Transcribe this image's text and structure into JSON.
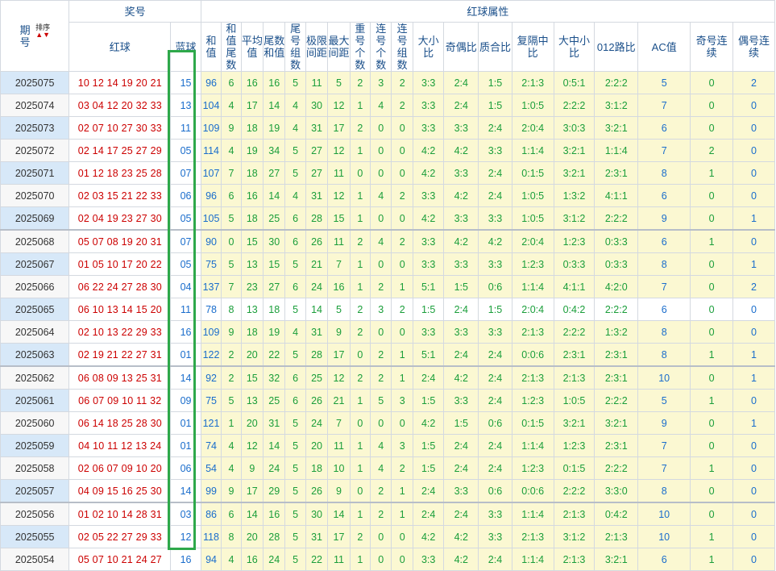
{
  "header": {
    "period": "期号",
    "sort": "排序",
    "prize": "奖号",
    "red_attr": "红球属性",
    "red": "红球",
    "blue": "蓝球",
    "cols": [
      "和值",
      "和值尾数",
      "平均值",
      "尾数和值",
      "尾号组数",
      "极限间距",
      "最大间距",
      "重号个数",
      "连号个数",
      "连号组数",
      "大小比",
      "奇偶比",
      "质合比",
      "复隔中比",
      "大中小比",
      "012路比",
      "AC值",
      "奇号连续",
      "偶号连续"
    ]
  },
  "rows": [
    {
      "p": "2025075",
      "r": "10 12 14 19 20 21",
      "b": "15",
      "a": [
        "96",
        "6",
        "16",
        "16",
        "5",
        "11",
        "5",
        "2",
        "3",
        "2",
        "3:3",
        "2:4",
        "1:5",
        "2:1:3",
        "0:5:1",
        "2:2:2",
        "5",
        "0",
        "2"
      ]
    },
    {
      "p": "2025074",
      "r": "03 04 12 20 32 33",
      "b": "13",
      "a": [
        "104",
        "4",
        "17",
        "14",
        "4",
        "30",
        "12",
        "1",
        "4",
        "2",
        "3:3",
        "2:4",
        "1:5",
        "1:0:5",
        "2:2:2",
        "3:1:2",
        "7",
        "0",
        "0"
      ]
    },
    {
      "p": "2025073",
      "r": "02 07 10 27 30 33",
      "b": "11",
      "a": [
        "109",
        "9",
        "18",
        "19",
        "4",
        "31",
        "17",
        "2",
        "0",
        "0",
        "3:3",
        "3:3",
        "2:4",
        "2:0:4",
        "3:0:3",
        "3:2:1",
        "6",
        "0",
        "0"
      ]
    },
    {
      "p": "2025072",
      "r": "02 14 17 25 27 29",
      "b": "05",
      "a": [
        "114",
        "4",
        "19",
        "34",
        "5",
        "27",
        "12",
        "1",
        "0",
        "0",
        "4:2",
        "4:2",
        "3:3",
        "1:1:4",
        "3:2:1",
        "1:1:4",
        "7",
        "2",
        "0"
      ]
    },
    {
      "p": "2025071",
      "r": "01 12 18 23 25 28",
      "b": "07",
      "a": [
        "107",
        "7",
        "18",
        "27",
        "5",
        "27",
        "11",
        "0",
        "0",
        "0",
        "4:2",
        "3:3",
        "2:4",
        "0:1:5",
        "3:2:1",
        "2:3:1",
        "8",
        "1",
        "0"
      ]
    },
    {
      "p": "2025070",
      "r": "02 03 15 21 22 33",
      "b": "06",
      "a": [
        "96",
        "6",
        "16",
        "14",
        "4",
        "31",
        "12",
        "1",
        "4",
        "2",
        "3:3",
        "4:2",
        "2:4",
        "1:0:5",
        "1:3:2",
        "4:1:1",
        "6",
        "0",
        "0"
      ]
    },
    {
      "p": "2025069",
      "r": "02 04 19 23 27 30",
      "b": "05",
      "a": [
        "105",
        "5",
        "18",
        "25",
        "6",
        "28",
        "15",
        "1",
        "0",
        "0",
        "4:2",
        "3:3",
        "3:3",
        "1:0:5",
        "3:1:2",
        "2:2:2",
        "9",
        "0",
        "1"
      ]
    },
    {
      "p": "2025068",
      "r": "05 07 08 19 20 31",
      "b": "07",
      "a": [
        "90",
        "0",
        "15",
        "30",
        "6",
        "26",
        "11",
        "2",
        "4",
        "2",
        "3:3",
        "4:2",
        "4:2",
        "2:0:4",
        "1:2:3",
        "0:3:3",
        "6",
        "1",
        "0"
      ]
    },
    {
      "p": "2025067",
      "r": "01 05 10 17 20 22",
      "b": "05",
      "a": [
        "75",
        "5",
        "13",
        "15",
        "5",
        "21",
        "7",
        "1",
        "0",
        "0",
        "3:3",
        "3:3",
        "3:3",
        "1:2:3",
        "0:3:3",
        "0:3:3",
        "8",
        "0",
        "1"
      ]
    },
    {
      "p": "2025066",
      "r": "06 22 24 27 28 30",
      "b": "04",
      "a": [
        "137",
        "7",
        "23",
        "27",
        "6",
        "24",
        "16",
        "1",
        "2",
        "1",
        "5:1",
        "1:5",
        "0:6",
        "1:1:4",
        "4:1:1",
        "4:2:0",
        "7",
        "0",
        "2"
      ]
    },
    {
      "p": "2025065",
      "r": "06 10 13 14 15 20",
      "b": "11",
      "a": [
        "78",
        "8",
        "13",
        "18",
        "5",
        "14",
        "5",
        "2",
        "3",
        "2",
        "1:5",
        "2:4",
        "1:5",
        "2:0:4",
        "0:4:2",
        "2:2:2",
        "6",
        "0",
        "0"
      ]
    },
    {
      "p": "2025064",
      "r": "02 10 13 22 29 33",
      "b": "16",
      "a": [
        "109",
        "9",
        "18",
        "19",
        "4",
        "31",
        "9",
        "2",
        "0",
        "0",
        "3:3",
        "3:3",
        "3:3",
        "2:1:3",
        "2:2:2",
        "1:3:2",
        "8",
        "0",
        "0"
      ]
    },
    {
      "p": "2025063",
      "r": "02 19 21 22 27 31",
      "b": "01",
      "a": [
        "122",
        "2",
        "20",
        "22",
        "5",
        "28",
        "17",
        "0",
        "2",
        "1",
        "5:1",
        "2:4",
        "2:4",
        "0:0:6",
        "2:3:1",
        "2:3:1",
        "8",
        "1",
        "1"
      ]
    },
    {
      "p": "2025062",
      "r": "06 08 09 13 25 31",
      "b": "14",
      "a": [
        "92",
        "2",
        "15",
        "32",
        "6",
        "25",
        "12",
        "2",
        "2",
        "1",
        "2:4",
        "4:2",
        "2:4",
        "2:1:3",
        "2:1:3",
        "2:3:1",
        "10",
        "0",
        "1"
      ]
    },
    {
      "p": "2025061",
      "r": "06 07 09 10 11 32",
      "b": "09",
      "a": [
        "75",
        "5",
        "13",
        "25",
        "6",
        "26",
        "21",
        "1",
        "5",
        "3",
        "1:5",
        "3:3",
        "2:4",
        "1:2:3",
        "1:0:5",
        "2:2:2",
        "5",
        "1",
        "0"
      ]
    },
    {
      "p": "2025060",
      "r": "06 14 18 25 28 30",
      "b": "01",
      "a": [
        "121",
        "1",
        "20",
        "31",
        "5",
        "24",
        "7",
        "0",
        "0",
        "0",
        "4:2",
        "1:5",
        "0:6",
        "0:1:5",
        "3:2:1",
        "3:2:1",
        "9",
        "0",
        "1"
      ]
    },
    {
      "p": "2025059",
      "r": "04 10 11 12 13 24",
      "b": "01",
      "a": [
        "74",
        "4",
        "12",
        "14",
        "5",
        "20",
        "11",
        "1",
        "4",
        "3",
        "1:5",
        "2:4",
        "2:4",
        "1:1:4",
        "1:2:3",
        "2:3:1",
        "7",
        "0",
        "0"
      ]
    },
    {
      "p": "2025058",
      "r": "02 06 07 09 10 20",
      "b": "06",
      "a": [
        "54",
        "4",
        "9",
        "24",
        "5",
        "18",
        "10",
        "1",
        "4",
        "2",
        "1:5",
        "2:4",
        "2:4",
        "1:2:3",
        "0:1:5",
        "2:2:2",
        "7",
        "1",
        "0"
      ]
    },
    {
      "p": "2025057",
      "r": "04 09 15 16 25 30",
      "b": "14",
      "a": [
        "99",
        "9",
        "17",
        "29",
        "5",
        "26",
        "9",
        "0",
        "2",
        "1",
        "2:4",
        "3:3",
        "0:6",
        "0:0:6",
        "2:2:2",
        "3:3:0",
        "8",
        "0",
        "0"
      ]
    },
    {
      "p": "2025056",
      "r": "01 02 10 14 28 31",
      "b": "03",
      "a": [
        "86",
        "6",
        "14",
        "16",
        "5",
        "30",
        "14",
        "1",
        "2",
        "1",
        "2:4",
        "2:4",
        "3:3",
        "1:1:4",
        "2:1:3",
        "0:4:2",
        "10",
        "0",
        "0"
      ]
    },
    {
      "p": "2025055",
      "r": "02 05 22 27 29 33",
      "b": "12",
      "a": [
        "118",
        "8",
        "20",
        "28",
        "5",
        "31",
        "17",
        "2",
        "0",
        "0",
        "4:2",
        "4:2",
        "3:3",
        "2:1:3",
        "3:1:2",
        "2:1:3",
        "10",
        "1",
        "0"
      ]
    },
    {
      "p": "2025054",
      "r": "05 07 10 21 24 27",
      "b": "16",
      "a": [
        "94",
        "4",
        "16",
        "24",
        "5",
        "22",
        "11",
        "1",
        "0",
        "0",
        "3:3",
        "4:2",
        "2:4",
        "1:1:4",
        "2:1:3",
        "3:2:1",
        "6",
        "1",
        "0"
      ]
    }
  ]
}
